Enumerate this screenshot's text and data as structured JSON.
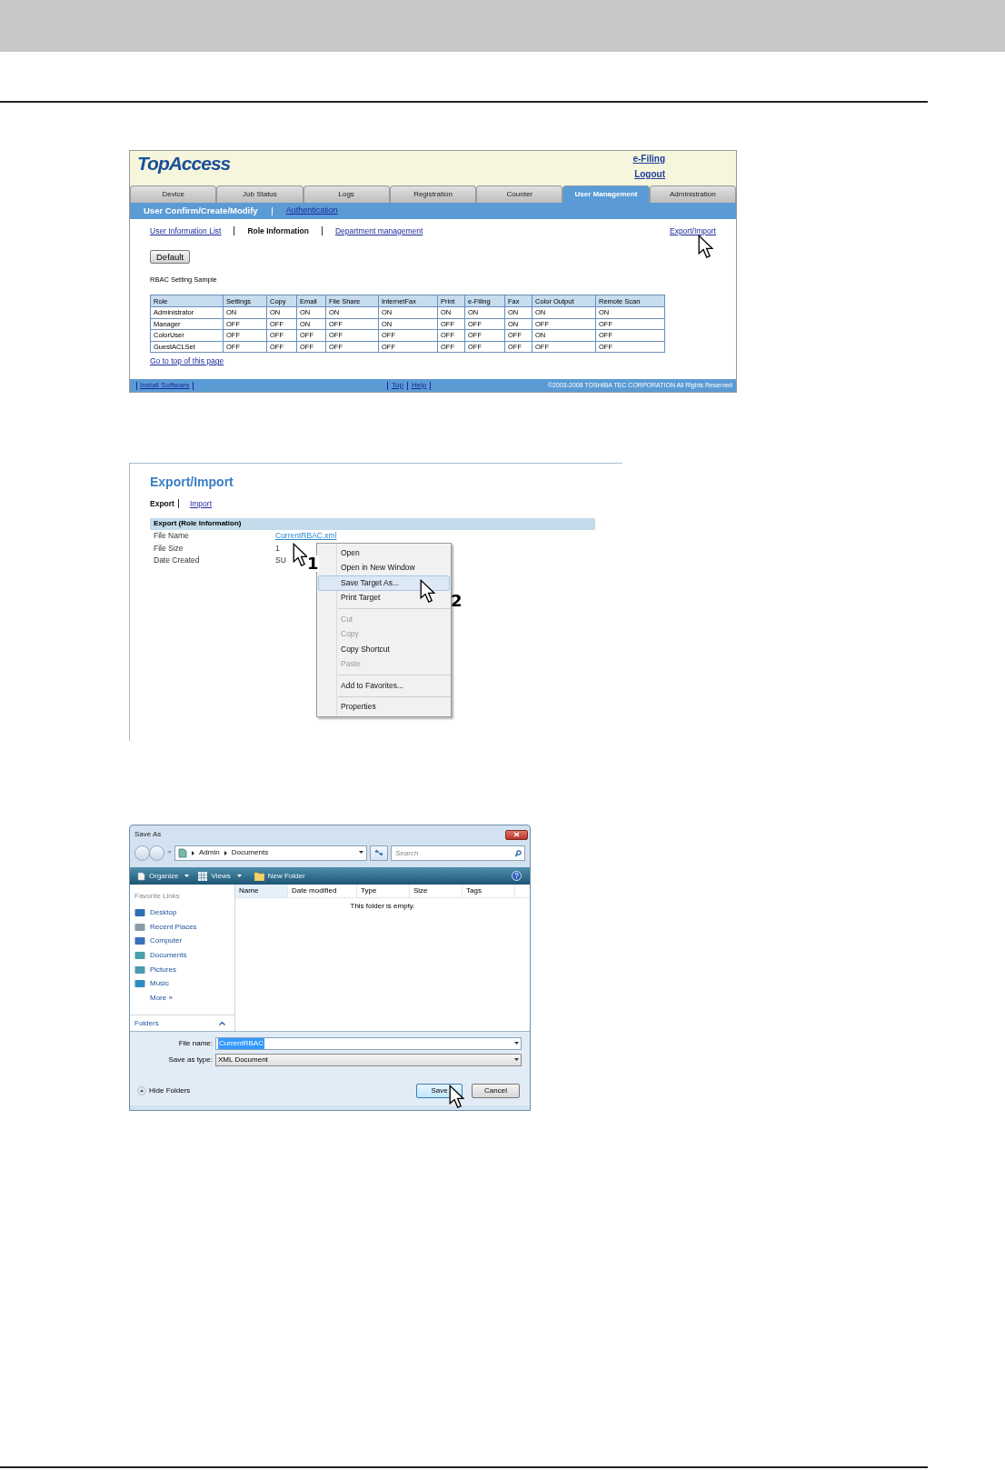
{
  "topaccess": {
    "logo": "TopAccess",
    "header_links": [
      "e-Filing",
      "Logout"
    ],
    "tabs": [
      {
        "label": "Device",
        "selected": false
      },
      {
        "label": "Job Status",
        "selected": false
      },
      {
        "label": "Logs",
        "selected": false
      },
      {
        "label": "Registration",
        "selected": false
      },
      {
        "label": "Counter",
        "selected": false
      },
      {
        "label": "User Management",
        "selected": true
      },
      {
        "label": "Administration",
        "selected": false
      }
    ],
    "subnav": [
      {
        "label": "User Confirm/Create/Modify",
        "selected": true
      },
      {
        "label": "Authentication",
        "selected": false
      }
    ],
    "subtabs": [
      {
        "label": "User Information List",
        "selected": false
      },
      {
        "label": "Role Information",
        "selected": true
      },
      {
        "label": "Department management",
        "selected": false
      }
    ],
    "export_link": "Export/Import",
    "default_button": "Default",
    "table_title": "RBAC Setting Sample",
    "table": {
      "columns": [
        "Role",
        "Settings",
        "Copy",
        "Email",
        "File Share",
        "InternetFax",
        "Print",
        "e-Filing",
        "Fax",
        "Color Output",
        "Remote Scan"
      ],
      "rows": [
        [
          "Administrator",
          "ON",
          "ON",
          "ON",
          "ON",
          "ON",
          "ON",
          "ON",
          "ON",
          "ON",
          "ON"
        ],
        [
          "Manager",
          "OFF",
          "OFF",
          "ON",
          "OFF",
          "ON",
          "OFF",
          "OFF",
          "ON",
          "OFF",
          "OFF"
        ],
        [
          "ColorUser",
          "OFF",
          "OFF",
          "OFF",
          "OFF",
          "OFF",
          "OFF",
          "OFF",
          "OFF",
          "ON",
          "OFF"
        ],
        [
          "GuestACLSet",
          "OFF",
          "OFF",
          "OFF",
          "OFF",
          "OFF",
          "OFF",
          "OFF",
          "OFF",
          "OFF",
          "OFF"
        ]
      ]
    },
    "top_link": "Go to top of this page",
    "footer": {
      "left_links": [
        "Install Software"
      ],
      "center_links": [
        "Top",
        "Help"
      ],
      "copyright": "©2003-2008 TOSHIBA TEC CORPORATION All Rights Reserved"
    }
  },
  "export_import": {
    "title": "Export/Import",
    "tabs": [
      {
        "label": "Export",
        "selected": true
      },
      {
        "label": "Import",
        "selected": false
      }
    ],
    "section": "Export (Role Information)",
    "fields": [
      {
        "label": "File Name",
        "value": "CurrentRBAC.xml",
        "kind": "link"
      },
      {
        "label": "File Size",
        "value": "1",
        "kind": "text"
      },
      {
        "label": "Date Created",
        "value": "SU",
        "kind": "text"
      }
    ],
    "context_menu": [
      [
        {
          "label": "Open",
          "disabled": false,
          "selected": false
        },
        {
          "label": "Open in New Window",
          "disabled": false,
          "selected": false
        },
        {
          "label": "Save Target As...",
          "disabled": false,
          "selected": true
        },
        {
          "label": "Print Target",
          "disabled": false,
          "selected": false
        }
      ],
      [
        {
          "label": "Cut",
          "disabled": true,
          "selected": false
        },
        {
          "label": "Copy",
          "disabled": true,
          "selected": false
        },
        {
          "label": "Copy Shortcut",
          "disabled": false,
          "selected": false
        },
        {
          "label": "Paste",
          "disabled": true,
          "selected": false
        }
      ],
      [
        {
          "label": "Add to Favorites...",
          "disabled": false,
          "selected": false
        }
      ],
      [
        {
          "label": "Properties",
          "disabled": false,
          "selected": false
        }
      ]
    ],
    "steps": [
      "1",
      "2"
    ]
  },
  "save_as": {
    "title": "Save As",
    "breadcrumb": [
      "Admin",
      "Documents"
    ],
    "search_placeholder": "Search",
    "toolbar": [
      {
        "label": "Organize",
        "dropdown": true
      },
      {
        "label": "Views",
        "dropdown": true
      },
      {
        "label": "New Folder",
        "dropdown": false
      }
    ],
    "favorites_title": "Favorite Links",
    "favorites": [
      "Desktop",
      "Recent Places",
      "Computer",
      "Documents",
      "Pictures",
      "Music"
    ],
    "more": "More »",
    "folders": "Folders",
    "columns": [
      {
        "label": "Name",
        "sorted": true
      },
      {
        "label": "Date modified",
        "sorted": false
      },
      {
        "label": "Type",
        "sorted": false
      },
      {
        "label": "Size",
        "sorted": false
      },
      {
        "label": "Tags",
        "sorted": false
      }
    ],
    "empty_message": "This folder is empty.",
    "file_name_label": "File name:",
    "file_name": "CurrentRBAC",
    "type_label": "Save as type:",
    "type_value": "XML Document",
    "hide_folders": "Hide Folders",
    "buttons": [
      "Save",
      "Cancel"
    ]
  }
}
